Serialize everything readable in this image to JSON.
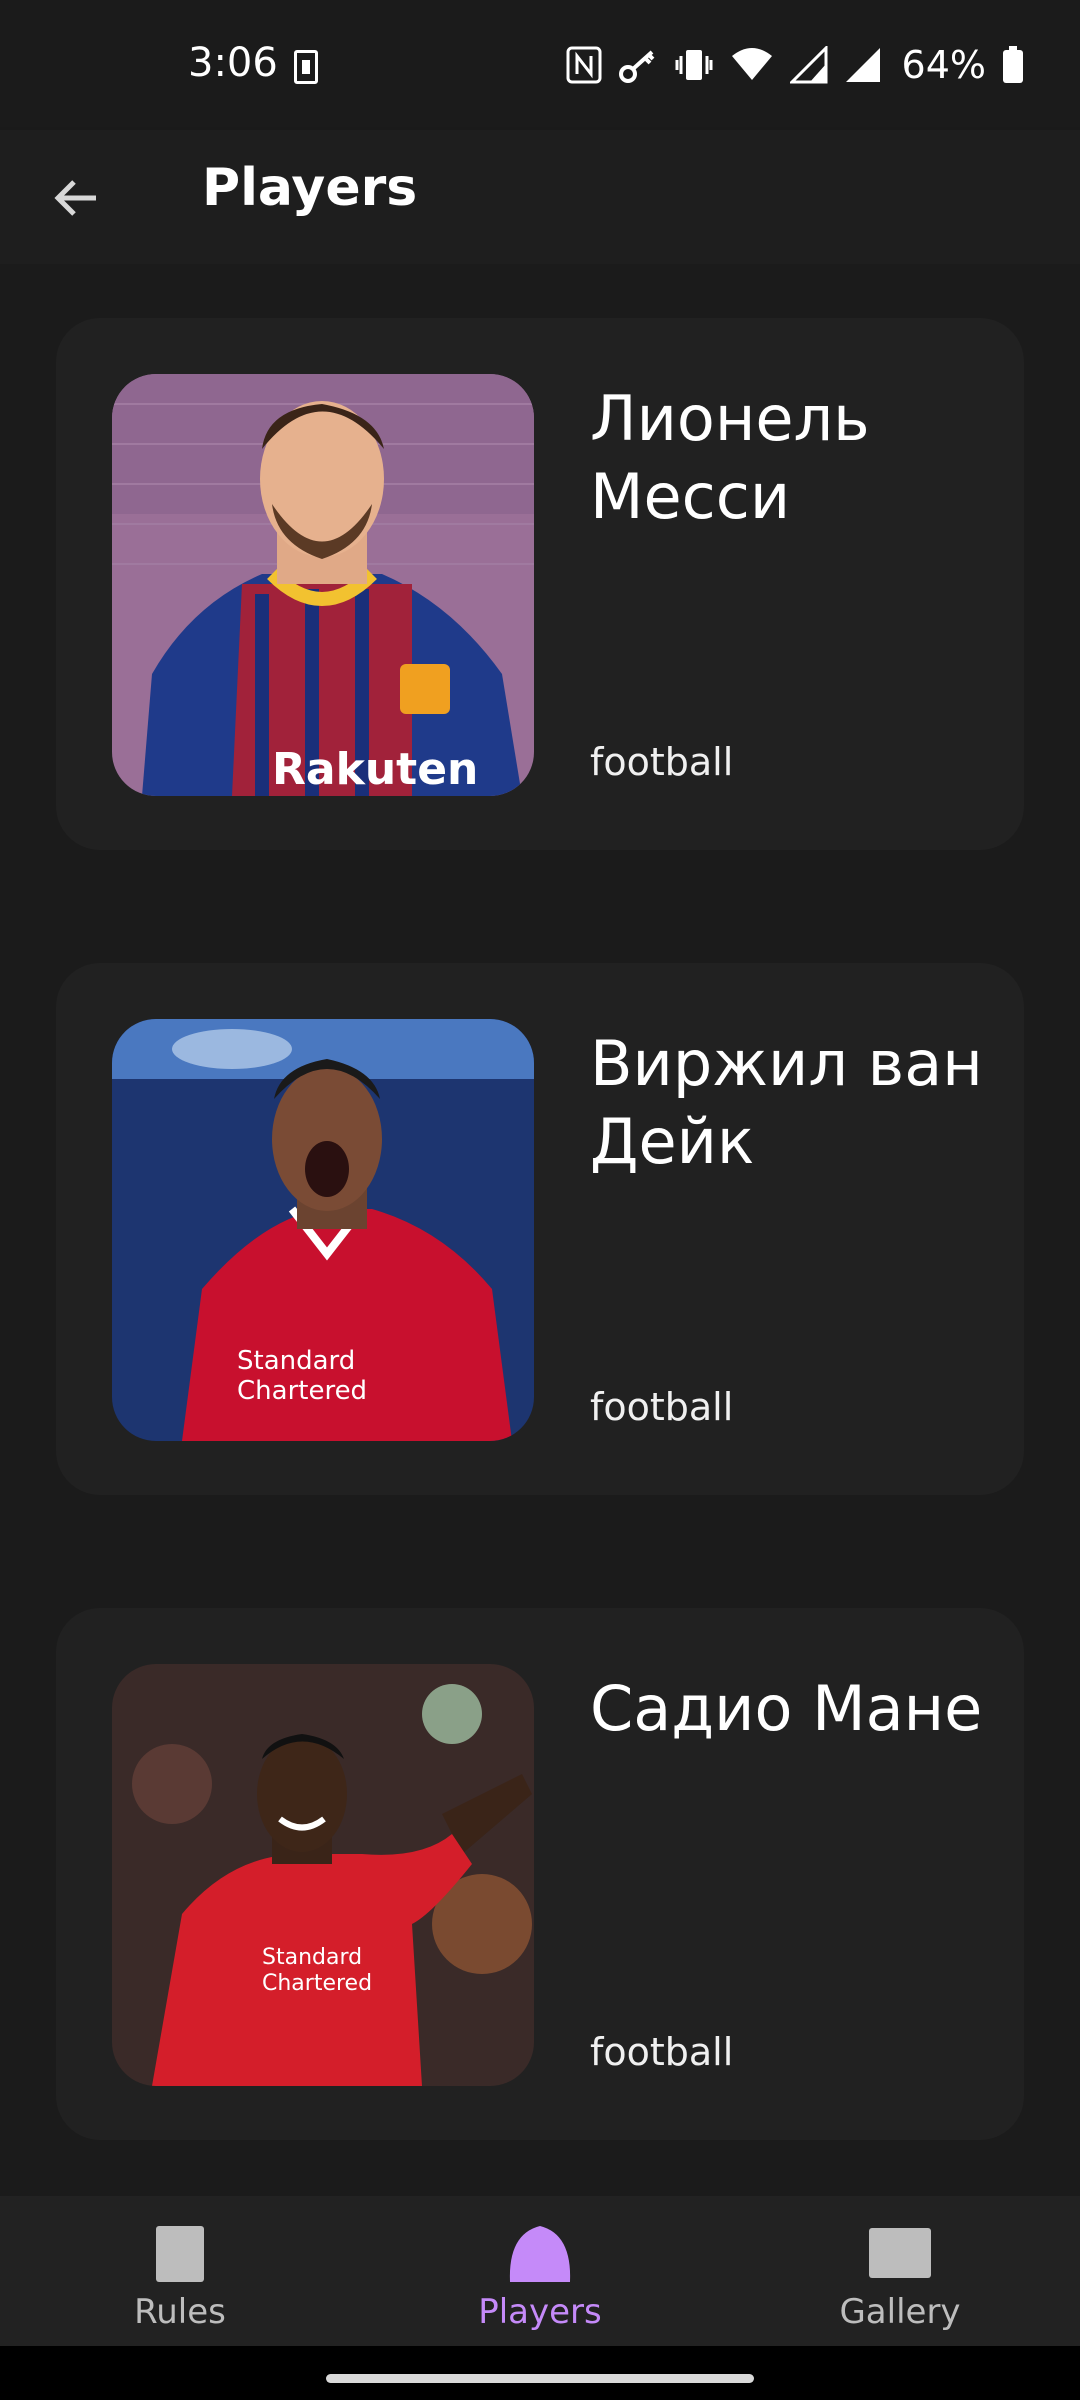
{
  "status_bar": {
    "time": "3:06",
    "battery": "64%",
    "icons": [
      "sim-icon",
      "nfc-icon",
      "key-icon",
      "vibrate-icon",
      "wifi-icon",
      "signal-icon",
      "signal-icon",
      "battery-icon"
    ]
  },
  "app_bar": {
    "title": "Players",
    "back_icon": "arrow-left-icon"
  },
  "players": [
    {
      "name": "Лионель Месси",
      "sport": "football"
    },
    {
      "name": "Виржил ван Дейк",
      "sport": "football"
    },
    {
      "name": "Садио Мане",
      "sport": "football"
    }
  ],
  "bottom_nav": {
    "items": [
      {
        "label": "Rules",
        "icon": "rules-icon",
        "active": false
      },
      {
        "label": "Players",
        "icon": "players-icon",
        "active": true
      },
      {
        "label": "Gallery",
        "icon": "gallery-icon",
        "active": false
      }
    ]
  },
  "colors": {
    "background": "#1b1b1b",
    "card": "#212121",
    "accent": "#c58af9",
    "nav_inactive": "#bdbdbd"
  }
}
